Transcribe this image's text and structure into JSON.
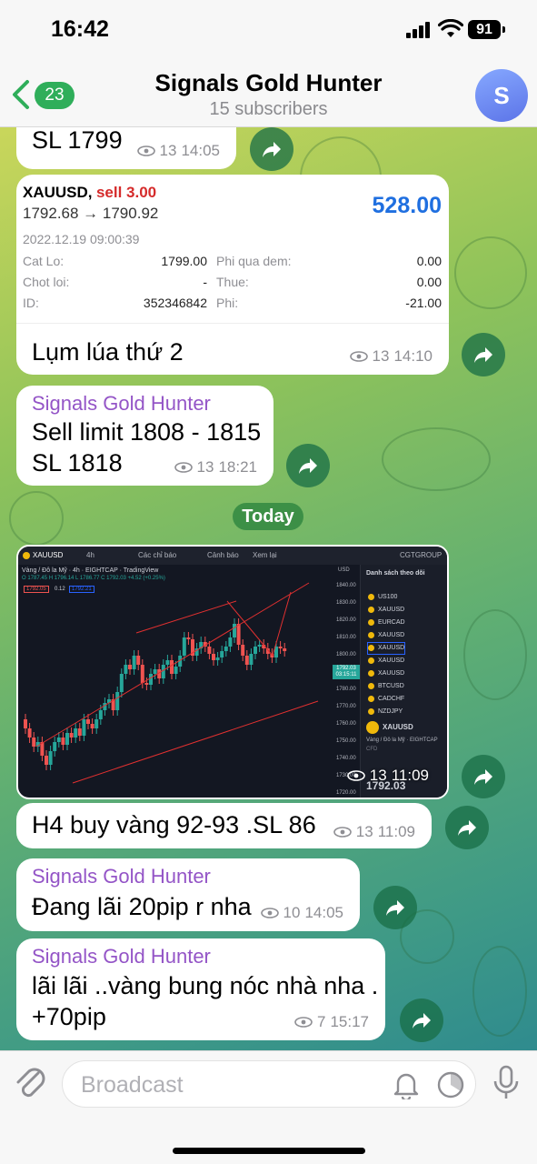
{
  "status_bar": {
    "time": "16:42",
    "battery": "91"
  },
  "header": {
    "back_count": "23",
    "title": "Signals Gold Hunter",
    "subtitle": "15 subscribers",
    "avatar_letter": "S"
  },
  "messages": {
    "m1": {
      "text": "SL 1799",
      "views": "13",
      "time": "14:05"
    },
    "m2": {
      "card": {
        "symbol": "XAUUSD,",
        "side": "sell 3.00",
        "price_move": "1792.68 → 1790.92",
        "profit": "528.00",
        "datetime": "2022.12.19 09:00:39",
        "rows": [
          {
            "l_label": "Cat Lo:",
            "l_value": "1799.00",
            "r_label": "Phi qua dem:",
            "r_value": "0.00"
          },
          {
            "l_label": "Chot loi:",
            "l_value": "-",
            "r_label": "Thue:",
            "r_value": "0.00"
          },
          {
            "l_label": "ID:",
            "l_value": "352346842",
            "r_label": "Phi:",
            "r_value": "-21.00"
          }
        ]
      },
      "text": "Lụm lúa thứ 2",
      "views": "13",
      "time": "14:10"
    },
    "m3": {
      "sender": "Signals Gold Hunter",
      "line1": "Sell limit 1808 - 1815",
      "line2": "SL 1818",
      "views": "13",
      "time": "18:21"
    },
    "date_separator": "Today",
    "m4": {
      "views": "13",
      "time": "11:09",
      "chart": {
        "symbol": "XAUUSD",
        "timeframe": "4h",
        "indicators": "Các chỉ báo",
        "alert": "Cảnh báo",
        "replay": "Xem lại",
        "broker": "CGTGROUP",
        "info_line": "Vàng / Đô la Mỹ · 4h · EIGHTCAP · TradingView",
        "ohlc": "O 1787.45  H 1796.14  L 1786.77  C 1792.03  +4.52 (+0.25%)",
        "bid": "1792.05",
        "spread": "0.12",
        "ask": "1792.21",
        "currency": "USD",
        "price_ticks": [
          "1840.00",
          "1830.00",
          "1820.00",
          "1810.00",
          "1800.00",
          "1790.00",
          "1780.00",
          "1770.00",
          "1760.00",
          "1750.00",
          "1740.00",
          "1730.00",
          "1720.00"
        ],
        "current_price": "1792.03",
        "countdown": "03:15:11",
        "watchlist_title": "Danh sách theo dõi",
        "watchlist": [
          "US100",
          "XAUUSD",
          "EURCAD",
          "XAUUSD",
          "XAUUSD",
          "XAUUSD",
          "XAUUSD",
          "BTCUSD",
          "CADCHF",
          "NZDJPY"
        ],
        "detail_symbol": "XAUUSD",
        "detail_name": "Vàng / Đô la Mỹ · EIGHTCAP",
        "detail_type": "CFD",
        "detail_price": "1792.03"
      }
    },
    "m5": {
      "text": "H4 buy vàng 92-93 .SL 86",
      "views": "13",
      "time": "11:09"
    },
    "m6": {
      "sender": "Signals Gold Hunter",
      "text": "Đang lãi 20pip r nha",
      "views": "10",
      "time": "14:05"
    },
    "m7": {
      "sender": "Signals Gold Hunter",
      "line1": "lãi lãi ..vàng bung nóc nhà nha .",
      "line2": "+70pip",
      "views": "7",
      "time": "15:17"
    }
  },
  "composer": {
    "placeholder": "Broadcast"
  },
  "colors": {
    "accent_green": "#2fae5a",
    "sender_purple": "#9455c7",
    "profit_blue": "#1f6fe0",
    "sell_red": "#d52b2b"
  }
}
